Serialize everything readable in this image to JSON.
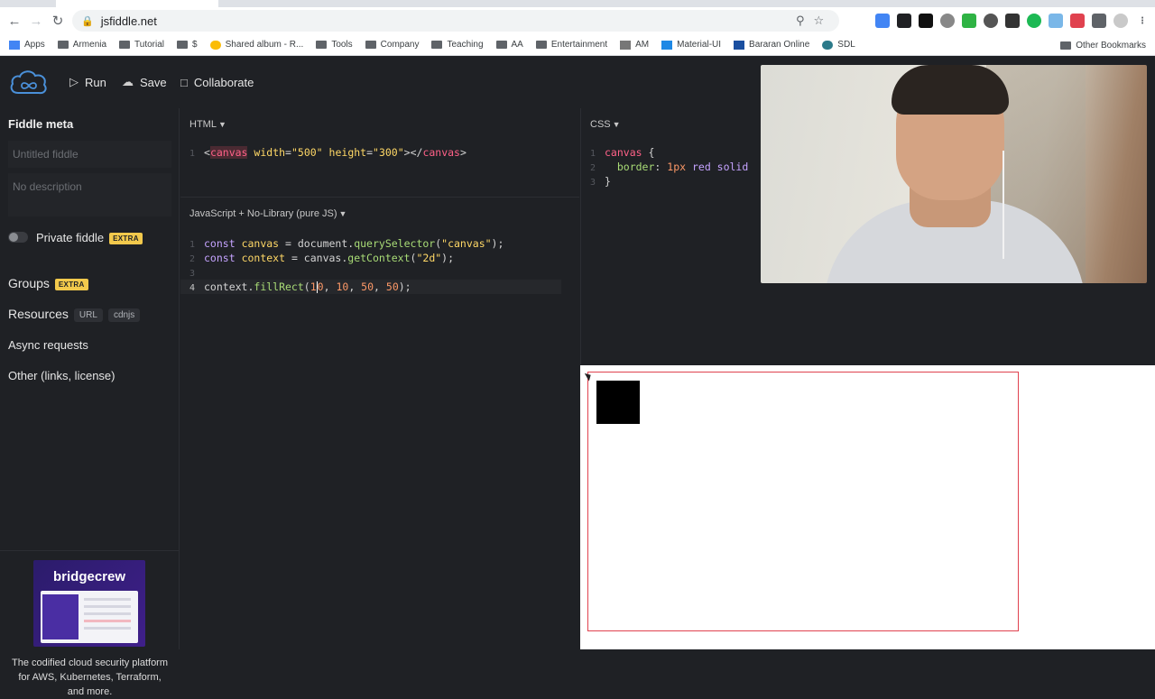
{
  "browser": {
    "url": "jsfiddle.net",
    "bookmarks": [
      "Apps",
      "Armenia",
      "Tutorial",
      "$",
      "Shared album - R...",
      "Tools",
      "Company",
      "Teaching",
      "AA",
      "Entertainment",
      "AM",
      "Material-UI",
      "Bararan Online",
      "SDL"
    ],
    "other_bookmarks": "Other Bookmarks"
  },
  "toolbar": {
    "run_label": "Run",
    "save_label": "Save",
    "collaborate_label": "Collaborate"
  },
  "sidebar": {
    "title": "Fiddle meta",
    "title_placeholder": "Untitled fiddle",
    "description_placeholder": "No description",
    "private_label": "Private fiddle",
    "extra_badge": "EXTRA",
    "groups_label": "Groups",
    "resources_label": "Resources",
    "resources_chips": [
      "URL",
      "cdnjs"
    ],
    "async_label": "Async requests",
    "other_label": "Other (links, license)",
    "ad": {
      "brand": "bridgecrew",
      "text": "The codified cloud security platform for AWS, Kubernetes, Terraform, and more."
    }
  },
  "panes": {
    "html_label": "HTML",
    "js_label": "JavaScript + No-Library (pure JS)",
    "css_label": "CSS"
  },
  "code": {
    "html": {
      "ln1": "1",
      "open_lt": "<",
      "tag": "canvas",
      "a1": "width",
      "v1": "\"500\"",
      "a2": "height",
      "v2": "\"300\"",
      "close": "></",
      "tag2": "canvas",
      "gt": ">"
    },
    "js": {
      "l1": {
        "n": "1",
        "kw": "const",
        "var": "canvas",
        "eq": " = document.",
        "fn": "querySelector",
        "p1": "(",
        "str": "\"canvas\"",
        "p2": ");"
      },
      "l2": {
        "n": "2",
        "kw": "const",
        "var": "context",
        "eq": " = canvas.",
        "fn": "getContext",
        "p1": "(",
        "str": "\"2d\"",
        "p2": ");"
      },
      "l3": {
        "n": "3"
      },
      "l4": {
        "n": "4",
        "obj": "context.",
        "fn": "fillRect",
        "p1": "(",
        "n1a": "1",
        "n1b": "0",
        "rest1": ", ",
        "n2": "10",
        "rest2": ", ",
        "n3": "50",
        "rest3": ", ",
        "n4": "50",
        "p2": ");"
      }
    },
    "css": {
      "l1": {
        "n": "1",
        "sel": "canvas",
        "brace": " {"
      },
      "l2": {
        "n": "2",
        "prop": "border",
        "colon": ": ",
        "num": "1px",
        "val": " red solid"
      },
      "l3": {
        "n": "3",
        "brace": "}"
      }
    }
  },
  "colors": {
    "canvas_border": "#e0424f",
    "accent_badge": "#f2c94c"
  }
}
